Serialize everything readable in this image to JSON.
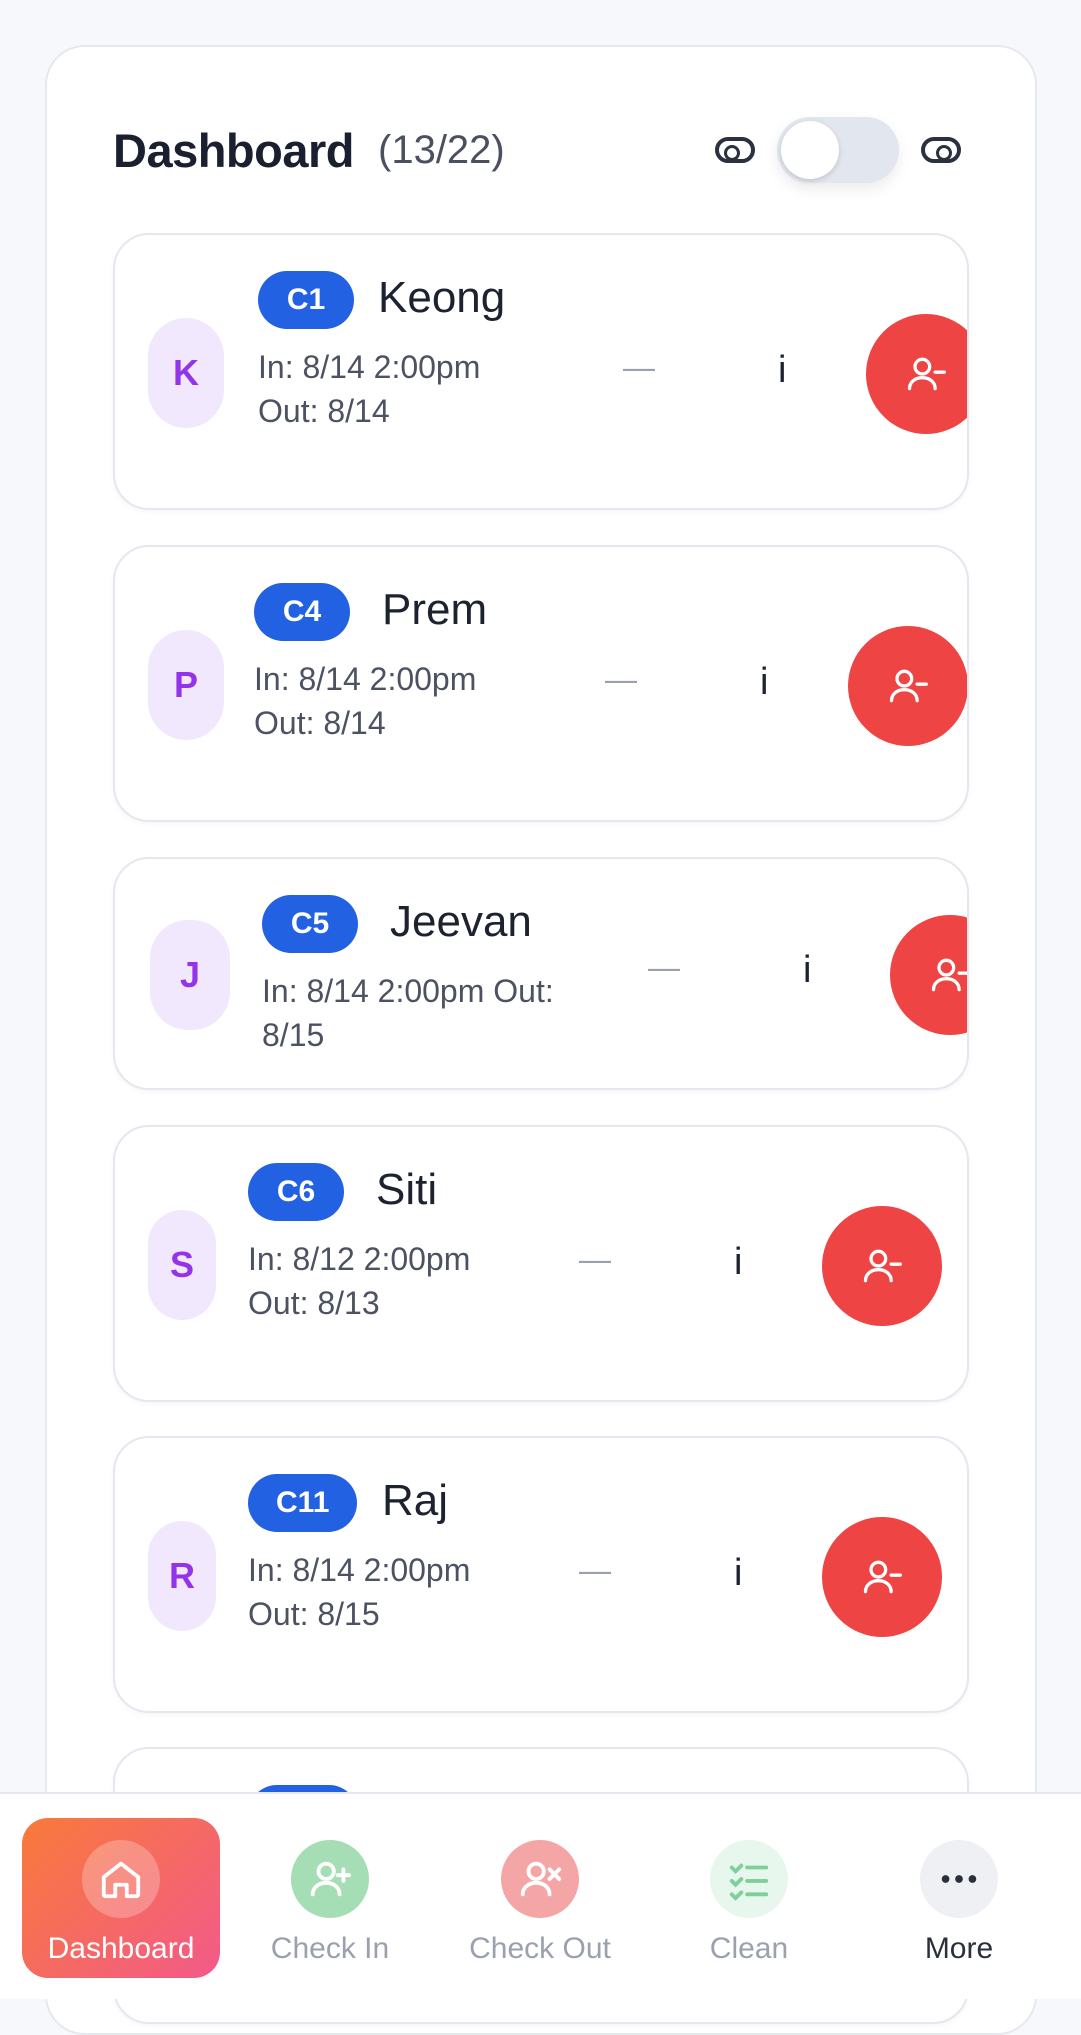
{
  "header": {
    "title": "Dashboard",
    "count": "(13/22)"
  },
  "bookings": [
    {
      "initial": "K",
      "room": "C1",
      "guest": "Keong",
      "dates": "In: 8/14 2:00pm  Out: 8/14",
      "dash": "—",
      "info": "i"
    },
    {
      "initial": "P",
      "room": "C4",
      "guest": "Prem",
      "dates": "In: 8/14 2:00pm  Out: 8/14",
      "dash": "—",
      "info": "i"
    },
    {
      "initial": "J",
      "room": "C5",
      "guest": "Jeevan",
      "dates": "In: 8/14 2:00pm  Out: 8/15",
      "dash": "—",
      "info": "i"
    },
    {
      "initial": "S",
      "room": "C6",
      "guest": "Siti",
      "dates": "In: 8/12 2:00pm  Out: 8/13",
      "dash": "—",
      "info": "i"
    },
    {
      "initial": "R",
      "room": "C11",
      "guest": "Raj",
      "dates": "In: 8/14 2:00pm  Out: 8/15",
      "dash": "—",
      "info": "i"
    }
  ],
  "nav": [
    {
      "label": "Dashboard",
      "icon": "home-icon",
      "active": true
    },
    {
      "label": "Check In",
      "icon": "user-plus-icon",
      "active": false
    },
    {
      "label": "Check Out",
      "icon": "user-x-icon",
      "active": false
    },
    {
      "label": "Clean",
      "icon": "checklist-icon",
      "active": false
    },
    {
      "label": "More",
      "icon": "more-icon",
      "active": false
    }
  ],
  "colors": {
    "room_badge": "#2361e3",
    "remove_button": "#ef4444",
    "avatar_bg": "#f2e8fd",
    "avatar_text": "#9333ea",
    "nav_active_start": "#f97a3a",
    "nav_active_end": "#f25a8a"
  }
}
